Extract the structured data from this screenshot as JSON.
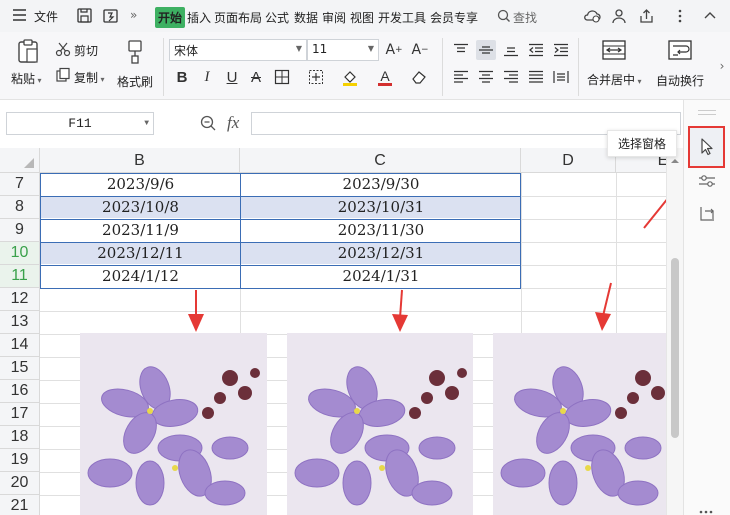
{
  "menubar": {
    "file_label": "文件",
    "tabs": [
      "开始",
      "插入",
      "页面布局",
      "公式",
      "数据",
      "审阅",
      "视图",
      "开发工具",
      "会员专享"
    ],
    "search_label": "查找"
  },
  "ribbon": {
    "paste_label": "粘贴",
    "cut_label": "剪切",
    "copy_label": "复制",
    "format_painter_label": "格式刷",
    "font_name": "宋体",
    "font_size": "11",
    "merge_label": "合并居中",
    "wrap_label": "自动换行"
  },
  "formula_bar": {
    "cell_ref": "F11",
    "fx_label": "fx",
    "value": ""
  },
  "sheet": {
    "columns": [
      "B",
      "C",
      "D",
      "E"
    ],
    "row_numbers": [
      "7",
      "8",
      "9",
      "10",
      "11",
      "12",
      "13",
      "14",
      "15",
      "16",
      "17",
      "18",
      "19",
      "20",
      "21"
    ],
    "rows": [
      {
        "b": "2023/9/6",
        "c": "2023/9/30"
      },
      {
        "b": "2023/10/8",
        "c": "2023/10/31"
      },
      {
        "b": "2023/11/9",
        "c": "2023/11/30"
      },
      {
        "b": "2023/12/11",
        "c": "2023/12/31"
      },
      {
        "b": "2024/1/12",
        "c": "2024/1/31"
      }
    ]
  },
  "side_panel": {
    "tooltip": "选择窗格"
  },
  "colors": {
    "accent_green": "#3db062",
    "table_border": "#3b6db5",
    "row_highlight": "#dbe1f1",
    "annotation_red": "#e53935"
  }
}
